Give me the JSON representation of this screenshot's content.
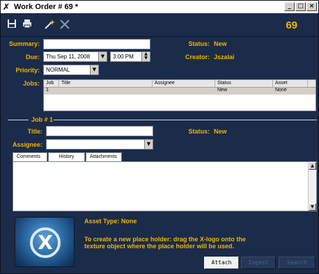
{
  "window": {
    "title": "Work Order # 69 *",
    "minimize_glyph": "_",
    "maximize_glyph": "□",
    "close_glyph": "×"
  },
  "toolbar": {
    "order_number": "69",
    "icons": [
      "save-icon",
      "print-icon",
      "wand-icon",
      "tools-icon"
    ]
  },
  "form": {
    "summary_label": "Summary:",
    "summary_value": "",
    "status_label": "Status:",
    "status_value": "New",
    "due_label": "Due:",
    "due_date": "Thu Sep 11, 2008",
    "due_time": "3:00 PM",
    "creator_label": "Creator:",
    "creator_value": "Jszalai",
    "priority_label": "Priority:",
    "priority_value": "NORMAL",
    "jobs_label": "Jobs:"
  },
  "jobs_table": {
    "columns": [
      "Job",
      "Title",
      "Assignee",
      "Status",
      "Asset"
    ],
    "rows": [
      {
        "job": "1",
        "title": "",
        "assignee": "",
        "status": "New",
        "asset": "None"
      }
    ]
  },
  "job_detail": {
    "header": "Job # 1",
    "title_label": "Title:",
    "title_value": "",
    "status_label": "Status:",
    "status_value": "New",
    "assignee_label": "Assignee:",
    "assignee_value": "",
    "tabs": [
      "Comments",
      "History",
      "Attachments"
    ],
    "active_tab": "Comments"
  },
  "asset": {
    "type_label": "Asset Type: None",
    "instructions": "To create a new place holder: drag the X-logo onto the texture object where the place holder will be used.",
    "buttons": {
      "attach": "Attach",
      "ingest": "Ingest",
      "search": "Search"
    }
  },
  "colors": {
    "panel_bg": "#1b2b4a",
    "accent": "#f0b400"
  }
}
